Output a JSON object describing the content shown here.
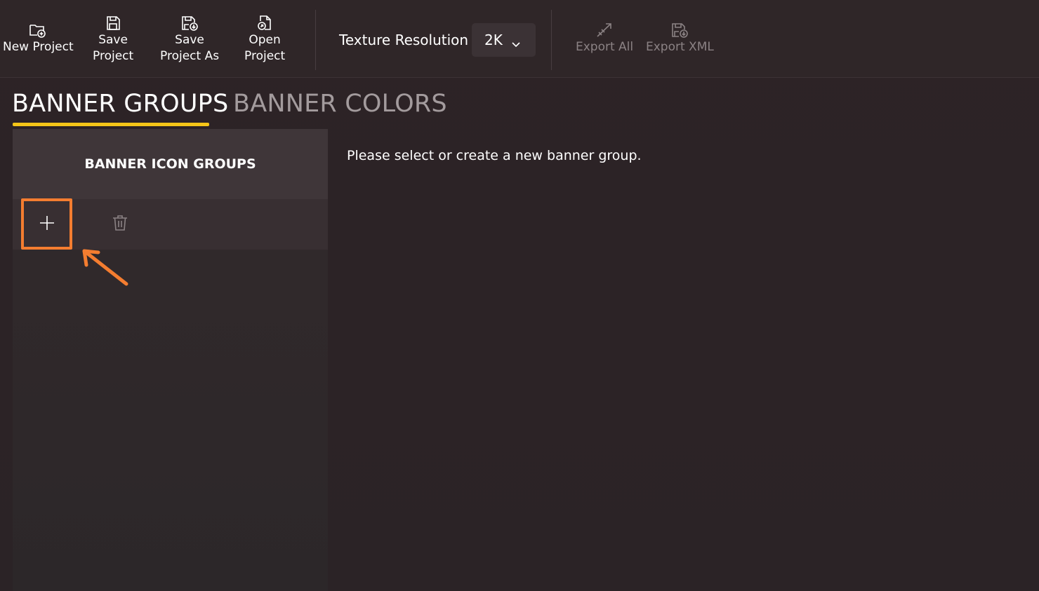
{
  "toolbar": {
    "new_project": "New Project",
    "save_project": "Save\nProject",
    "save_project_as": "Save\nProject As",
    "open_project": "Open\nProject",
    "texture_resolution_label": "Texture Resolution",
    "texture_resolution_value": "2K",
    "export_all": "Export All",
    "export_xml": "Export XML"
  },
  "tabs": [
    {
      "label": "BANNER GROUPS",
      "active": true
    },
    {
      "label": "BANNER COLORS",
      "active": false
    }
  ],
  "panel": {
    "header": "BANNER ICON GROUPS"
  },
  "main": {
    "message": "Please select or create a new banner group."
  },
  "colors": {
    "accent_underline": "#f5c518",
    "highlight": "#f47d30",
    "background": "#2c2225"
  }
}
